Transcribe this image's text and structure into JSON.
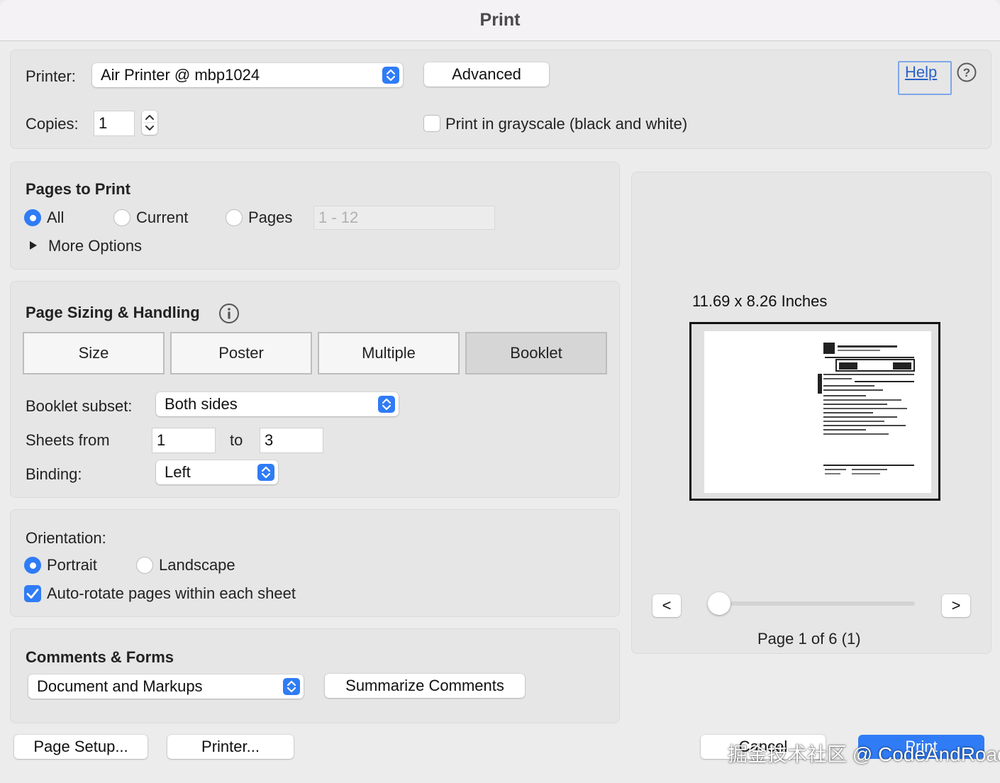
{
  "window": {
    "title": "Print"
  },
  "printer_section": {
    "printer_label": "Printer:",
    "printer_value": "Air Printer @ mbp1024",
    "advanced_label": "Advanced",
    "help_label": "Help",
    "help_icon": "question-circle-icon",
    "copies_label": "Copies:",
    "copies_value": "1",
    "grayscale_label": "Print in grayscale (black and white)",
    "grayscale_checked": false
  },
  "pages_to_print": {
    "title": "Pages to Print",
    "options": [
      {
        "label": "All",
        "selected": true
      },
      {
        "label": "Current",
        "selected": false
      },
      {
        "label": "Pages",
        "selected": false
      }
    ],
    "pages_range_placeholder": "1 - 12",
    "more_options_label": "More Options"
  },
  "page_sizing": {
    "title": "Page Sizing & Handling",
    "info_icon": "info-circle-icon",
    "modes": [
      {
        "label": "Size",
        "selected": false
      },
      {
        "label": "Poster",
        "selected": false
      },
      {
        "label": "Multiple",
        "selected": false
      },
      {
        "label": "Booklet",
        "selected": true
      }
    ],
    "booklet_subset_label": "Booklet subset:",
    "booklet_subset_value": "Both sides",
    "sheets_from_label": "Sheets from",
    "sheets_from_value": "1",
    "sheets_to_label": "to",
    "sheets_to_value": "3",
    "binding_label": "Binding:",
    "binding_value": "Left"
  },
  "orientation": {
    "title": "Orientation:",
    "options": [
      {
        "label": "Portrait",
        "selected": true
      },
      {
        "label": "Landscape",
        "selected": false
      }
    ],
    "auto_rotate_label": "Auto-rotate pages within each sheet",
    "auto_rotate_checked": true
  },
  "comments_forms": {
    "title": "Comments & Forms",
    "value": "Document and Markups",
    "summarize_label": "Summarize Comments"
  },
  "preview": {
    "size_label": "11.69 x 8.26 Inches",
    "prev_label": "<",
    "next_label": ">",
    "page_indicator": "Page 1 of 6 (1)"
  },
  "footer": {
    "page_setup_label": "Page Setup...",
    "printer_label": "Printer...",
    "cancel_label": "Cancel",
    "print_label": "Print",
    "accent_color": "#2f7cf6"
  },
  "watermark": {
    "text": "掘金技术社区 @ CodeAndRoad"
  }
}
